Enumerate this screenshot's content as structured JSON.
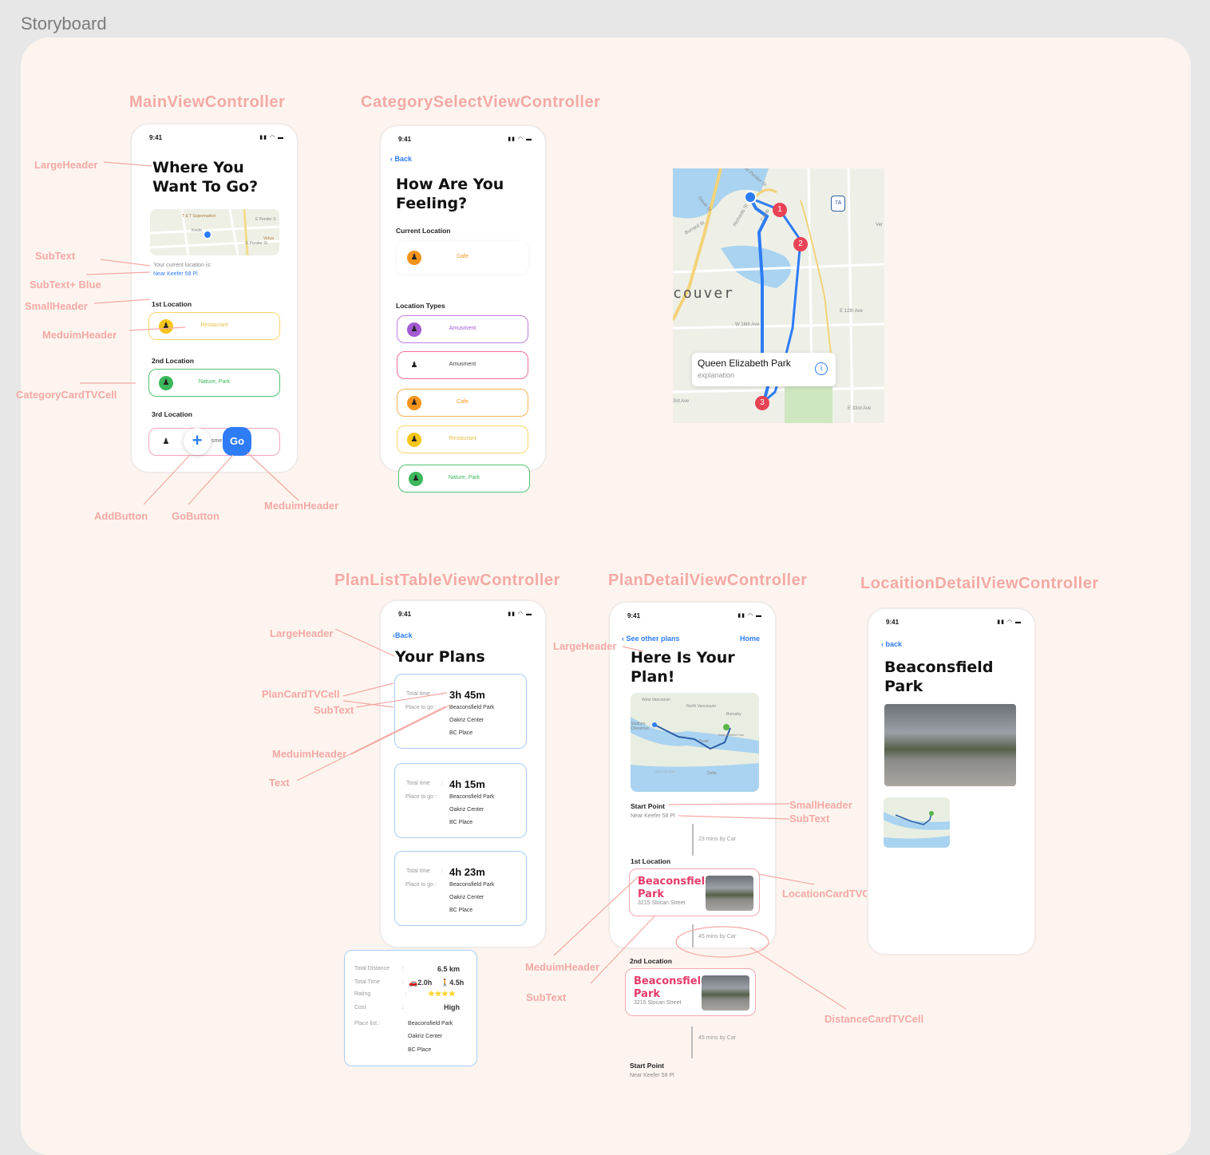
{
  "page_title": "Storyboard",
  "vc_titles": {
    "main": "MainViewController",
    "category": "CategorySelectViewController",
    "planlist": "PlanListTableViewController",
    "plandetail": "PlanDetailViewController",
    "locdetail": "LocaitionDetailViewController"
  },
  "annotations": {
    "large_header": "LargeHeader",
    "subtext": "SubText",
    "subtext_blue": "SubText+ Blue",
    "small_header": "SmallHeader",
    "medium_header": "MeduimHeader",
    "category_card": "CategoryCardTVCell",
    "add_button": "AddButton",
    "go_button": "GoButton",
    "plan_card": "PlanCardTVCell",
    "text": "Text",
    "location_card": "LocationCardTVCell",
    "distance_card": "DistanceCardTVCell"
  },
  "status_time": "9:41",
  "main": {
    "title": "Where You Want To Go?",
    "map_labels": [
      "T & T Supermarket",
      "E Pender S",
      "Keefe",
      "Virtua",
      "Gore Ave",
      "E Pender St"
    ],
    "current_location_label": "Your current location is:",
    "current_location_value": "Near Keefer 58 Pl",
    "sections": [
      {
        "title": "1st Location",
        "card": "Restaurant"
      },
      {
        "title": "2nd Location",
        "card": "Nature, Park"
      },
      {
        "title": "3rd Location",
        "card": "sme"
      }
    ],
    "go_label": "Go",
    "add_label": "+"
  },
  "category": {
    "back": "Back",
    "title": "How Are You Feeling?",
    "current_location": "Current Location",
    "current_card": "Cafe",
    "types_title": "Location Types",
    "types": [
      "Amusment",
      "Amusment",
      "Cafe",
      "Restaurant",
      "Nature, Park"
    ]
  },
  "bigmap": {
    "place": "Queen Elizabeth Park",
    "sub": "explanation",
    "labels": [
      "W Pender St",
      "Davie St",
      "Burrard St",
      "Richards St",
      "Camb",
      "couver",
      "Ver",
      "E 12th Ave",
      "W 16th Ave",
      "3rd Ave",
      "E 33rd Ave",
      "7A"
    ],
    "pins": [
      "1",
      "2",
      "3"
    ]
  },
  "planlist": {
    "back": "Back",
    "title": "Your Plans",
    "total_time_label": "Total time",
    "place_label": "Place to go :",
    "plans": [
      {
        "time": "3h 45m",
        "places": [
          "Beaconsfield Park",
          "Oakriz Center",
          "BC Place"
        ]
      },
      {
        "time": "4h 15m",
        "places": [
          "Beaconsfield Park",
          "Oakriz Center",
          "BC Place"
        ]
      },
      {
        "time": "4h 23m",
        "places": [
          "Beaconsfield Park",
          "Oakriz Center",
          "BC Place"
        ]
      }
    ],
    "colon": ":"
  },
  "summary": {
    "total_distance_label": "Total Distance",
    "total_distance": "6.5 km",
    "total_time_label": "Total Time",
    "car_time": "🚗2.0h",
    "walk_time": "🚶4.5h",
    "rating_label": "Rating",
    "rating": "⭐⭐⭐⭐",
    "cost_label": "Cost",
    "cost": "High",
    "place_list_label": "Place list :",
    "places": [
      "Beaconsfield Park",
      "Oakriz Center",
      "BC Place"
    ],
    "colon": ":"
  },
  "plandetail": {
    "back": "See other plans",
    "home": "Home",
    "title": "Here Is Your Plan!",
    "map_labels": [
      "West Vancouver",
      "North Vancouver",
      "Stadium-Chinatown",
      "Burnaby",
      "Beaconsfield Park",
      "Braid",
      "Delta",
      "LULU ISLAND"
    ],
    "start_label": "Start Point",
    "start_value": "Near Keefer 58 Pl",
    "d1": "23 mins by Car",
    "loc1_label": "1st Location",
    "loc1_name": "Beaconsfield Park",
    "loc1_addr": "3215 Slocan Street",
    "d2": "45 mins by Car",
    "loc2_label": "2nd Location",
    "loc2_name": "Beaconsfield Park",
    "loc2_addr": "3215 Slocan Street",
    "d3": "45 mins by Car",
    "end_label": "Start Point",
    "end_value": "Near Keefer 58 Pl"
  },
  "locdetail": {
    "back": "back",
    "title": "Beaconsfield Park"
  },
  "colors": {
    "accent": "#2e7cf6",
    "annotation": "#f5a9a4",
    "pink": "#e63a6a"
  }
}
